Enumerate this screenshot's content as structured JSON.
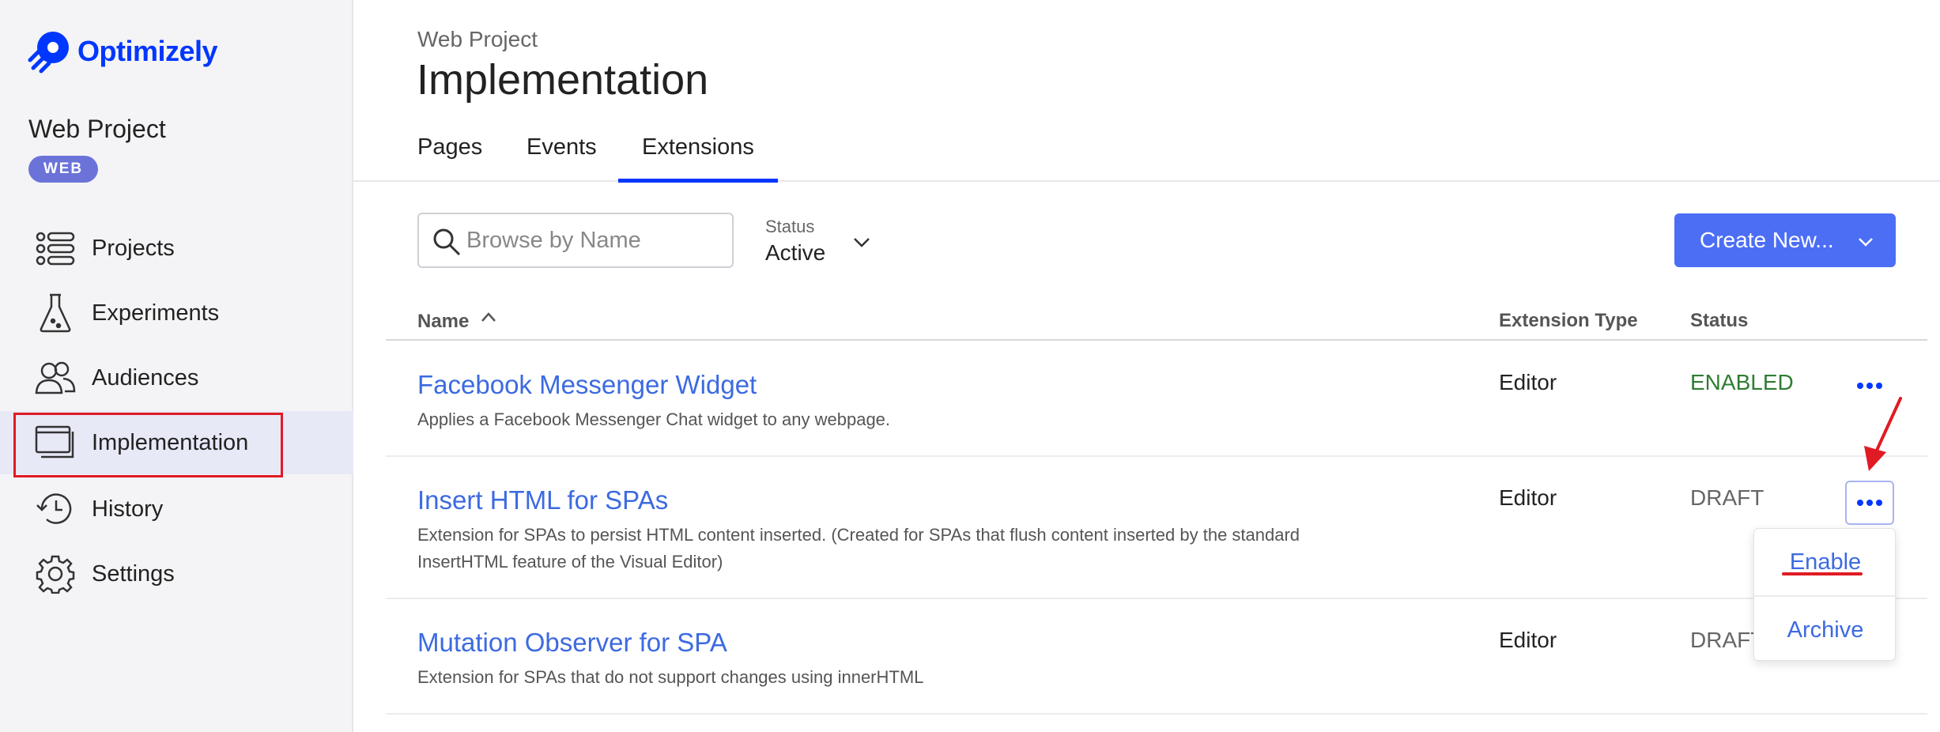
{
  "app": {
    "logo_text": "Optimizely",
    "brand_color": "#0037ff"
  },
  "sidebar": {
    "project_name": "Web Project",
    "badge": "WEB",
    "items": [
      {
        "label": "Projects",
        "icon": "list-icon"
      },
      {
        "label": "Experiments",
        "icon": "flask-icon"
      },
      {
        "label": "Audiences",
        "icon": "people-icon"
      },
      {
        "label": "Implementation",
        "icon": "browser-windows-icon",
        "active": true
      },
      {
        "label": "History",
        "icon": "history-icon"
      },
      {
        "label": "Settings",
        "icon": "gear-icon"
      }
    ]
  },
  "header": {
    "breadcrumb": "Web Project",
    "title": "Implementation",
    "tabs": [
      {
        "label": "Pages"
      },
      {
        "label": "Events"
      },
      {
        "label": "Extensions",
        "active": true
      }
    ]
  },
  "toolbar": {
    "search_placeholder": "Browse by Name",
    "status_label": "Status",
    "status_value": "Active",
    "create_label": "Create New..."
  },
  "table": {
    "columns": [
      "Name",
      "Extension Type",
      "Status"
    ],
    "sort_indicator": "^",
    "rows": [
      {
        "name": "Facebook Messenger Widget",
        "description": "Applies a Facebook Messenger Chat widget to any webpage.",
        "type": "Editor",
        "status": "ENABLED",
        "status_color": "#2e7d32"
      },
      {
        "name": "Insert HTML for SPAs",
        "description": "Extension for SPAs to persist HTML content inserted. (Created for SPAs that flush content inserted by the standard InsertHTML feature of the Visual Editor)",
        "type": "Editor",
        "status": "DRAFT",
        "status_color": "#666666"
      },
      {
        "name": "Mutation Observer for SPA",
        "description": "Extension for SPAs that do not support changes using innerHTML",
        "type": "Editor",
        "status": "DRAFT",
        "status_color": "#666666"
      }
    ]
  },
  "menu": {
    "items": [
      "Enable",
      "Archive"
    ]
  },
  "annotations": {
    "highlight_color": "#e01b24"
  }
}
